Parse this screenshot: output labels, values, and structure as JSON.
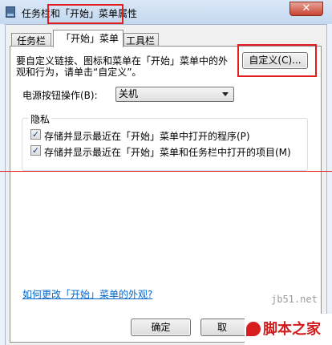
{
  "window": {
    "title": "任务栏和「开始」菜单属性",
    "close_label": "✕"
  },
  "tabs": [
    {
      "label": "任务栏"
    },
    {
      "label": "「开始」菜单",
      "selected": true
    },
    {
      "label": "工具栏"
    }
  ],
  "start_menu": {
    "description": "要自定义链接、图标和菜单在「开始」菜单中的外观和行为，请单击“自定义”。",
    "customize_button": "自定义(C)...",
    "power_label": "电源按钮操作(B):",
    "power_value": "关机",
    "privacy": {
      "legend": "隐私",
      "items": [
        {
          "label": "存储并显示最近在「开始」菜单中打开的程序(P)",
          "checked": true
        },
        {
          "label": "存储并显示最近在「开始」菜单和任务栏中打开的项目(M)",
          "checked": true
        }
      ]
    },
    "help_link": "如何更改「开始」菜单的外观?"
  },
  "buttons": {
    "ok": "确定",
    "cancel": "取"
  },
  "watermark": {
    "site": "jb51.net",
    "brand": "脚本之家"
  },
  "colors": {
    "highlight": "#e31d1d",
    "link": "#0066cc"
  }
}
